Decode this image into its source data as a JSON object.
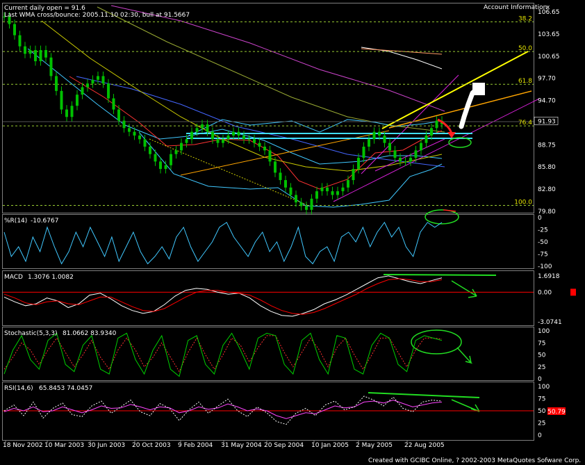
{
  "header": {
    "line1": "Current daily open = 91.6",
    "line2": "Last WMA cross/bounce: 2005.11.10 02:30, bull at 91.5667",
    "account_info": "Account Information",
    "close_glyph": "x"
  },
  "credit": "Created with GCIBC Online, ? 2002-2003 MetaQuotes Sofware Corp.",
  "chart_data": [
    {
      "type": "line",
      "name_label": "",
      "x_tick_labels": [
        "18 Nov 2002",
        "10 Mar 2003",
        "30 Jun 2003",
        "20 Oct 2003",
        "9 Feb 2004",
        "31 May 2004",
        "20 Sep 2004",
        "10 Jan 2005",
        "2 May 2005",
        "22 Aug 2005"
      ],
      "y_tick_labels": [
        "106.65",
        "103.65",
        "100.65",
        "97.70",
        "94.70",
        "91.93",
        "88.75",
        "85.80",
        "82.80",
        "79.80"
      ],
      "ylim": [
        79.8,
        106.65
      ],
      "current_price": "91.93",
      "fib_levels": [
        {
          "label": "38.2",
          "value": 105.3
        },
        {
          "label": "50.0",
          "value": 101.3
        },
        {
          "label": "61.8",
          "value": 96.9
        },
        {
          "label": "76.4",
          "value": 91.3
        },
        {
          "label": "100.0",
          "value": 80.6
        }
      ],
      "close": [
        106.0,
        105.0,
        103.5,
        102.0,
        101.0,
        101.5,
        100.0,
        101.5,
        100.5,
        98.0,
        96.0,
        93.5,
        92.5,
        94.0,
        95.5,
        96.5,
        97.0,
        97.5,
        98.0,
        97.0,
        95.0,
        93.5,
        92.0,
        91.0,
        90.5,
        90.0,
        89.5,
        88.5,
        87.5,
        86.5,
        85.5,
        86.0,
        87.5,
        88.0,
        89.0,
        89.5,
        90.5,
        91.0,
        91.5,
        90.5,
        89.5,
        89.0,
        89.5,
        90.0,
        90.5,
        90.0,
        89.5,
        89.5,
        89.0,
        88.5,
        88.0,
        86.5,
        85.0,
        84.0,
        83.0,
        82.0,
        81.0,
        80.5,
        80.0,
        81.5,
        82.5,
        83.0,
        82.5,
        82.0,
        82.5,
        83.0,
        84.0,
        85.5,
        87.0,
        88.5,
        89.5,
        90.5,
        90.0,
        89.0,
        88.0,
        87.0,
        86.5,
        86.5,
        87.0,
        88.0,
        89.0,
        90.0,
        91.0,
        92.0,
        91.5
      ]
    },
    {
      "type": "line",
      "name_label": "%R(14)",
      "values_label": "-10.6767",
      "y_tick_labels": [
        "0",
        "-25",
        "-50",
        "-75",
        "-100"
      ],
      "ylim": [
        -100,
        0
      ],
      "values": [
        -30,
        -80,
        -60,
        -90,
        -40,
        -70,
        -20,
        -60,
        -95,
        -70,
        -30,
        -60,
        -20,
        -50,
        -80,
        -40,
        -90,
        -60,
        -30,
        -70,
        -95,
        -80,
        -60,
        -85,
        -40,
        -20,
        -60,
        -90,
        -70,
        -50,
        -20,
        -10,
        -40,
        -60,
        -80,
        -50,
        -30,
        -70,
        -50,
        -90,
        -60,
        -20,
        -80,
        -95,
        -70,
        -60,
        -90,
        -40,
        -30,
        -50,
        -20,
        -60,
        -30,
        -10,
        -40,
        -20,
        -60,
        -80,
        -30,
        -10,
        -20,
        -10
      ]
    },
    {
      "type": "line",
      "name_label": "MACD",
      "values_label": "1.3076 1.0082",
      "y_tick_labels": [
        "1.6918",
        "0.00",
        "-3.0741"
      ],
      "ylim": [
        -3.0741,
        1.6918
      ],
      "series": [
        {
          "name": "main",
          "values": [
            -0.5,
            -1.0,
            -1.4,
            -1.2,
            -0.6,
            -0.9,
            -1.6,
            -1.2,
            -0.3,
            -0.1,
            -0.7,
            -1.4,
            -1.9,
            -2.2,
            -2.0,
            -1.3,
            -0.4,
            0.2,
            0.4,
            0.3,
            0.0,
            -0.2,
            -0.1,
            -0.6,
            -1.4,
            -2.0,
            -2.4,
            -2.5,
            -2.2,
            -1.8,
            -1.2,
            -0.8,
            -0.3,
            0.3,
            0.9,
            1.5,
            1.7,
            1.4,
            1.1,
            0.9,
            1.2,
            1.5
          ]
        },
        {
          "name": "signal",
          "values": [
            -0.2,
            -0.6,
            -1.1,
            -1.3,
            -1.0,
            -0.9,
            -1.2,
            -1.3,
            -0.9,
            -0.5,
            -0.5,
            -1.0,
            -1.5,
            -1.9,
            -2.0,
            -1.7,
            -1.1,
            -0.5,
            0.0,
            0.2,
            0.2,
            0.0,
            -0.1,
            -0.3,
            -0.8,
            -1.4,
            -1.9,
            -2.2,
            -2.3,
            -2.1,
            -1.7,
            -1.2,
            -0.7,
            -0.2,
            0.4,
            0.9,
            1.3,
            1.4,
            1.3,
            1.1,
            1.1,
            1.3
          ]
        }
      ]
    },
    {
      "type": "line",
      "name_label": "Stochastic(5,3,3)",
      "values_label": "81.0662 83.9340",
      "y_tick_labels": [
        "100",
        "75",
        "50",
        "25",
        "0"
      ],
      "ylim": [
        0,
        100
      ],
      "series": [
        {
          "name": "main",
          "values": [
            10,
            60,
            90,
            40,
            20,
            80,
            95,
            30,
            15,
            70,
            90,
            20,
            10,
            85,
            95,
            40,
            10,
            60,
            90,
            20,
            5,
            80,
            90,
            30,
            10,
            70,
            95,
            60,
            20,
            85,
            95,
            90,
            30,
            10,
            80,
            95,
            40,
            10,
            90,
            85,
            20,
            10,
            70,
            95,
            85,
            30,
            15,
            80,
            90,
            85,
            80
          ]
        },
        {
          "name": "signal",
          "values": [
            20,
            45,
            75,
            60,
            30,
            60,
            85,
            55,
            25,
            50,
            80,
            45,
            20,
            60,
            85,
            60,
            25,
            45,
            75,
            45,
            15,
            55,
            85,
            50,
            20,
            50,
            85,
            70,
            35,
            65,
            90,
            90,
            55,
            25,
            55,
            85,
            60,
            25,
            65,
            85,
            50,
            20,
            50,
            85,
            85,
            55,
            25,
            60,
            85,
            85,
            83
          ]
        }
      ]
    },
    {
      "type": "line",
      "name_label": "RSI(14,6)",
      "values_label": "65.8453 74.0457",
      "y_tick_labels": [
        "100",
        "75",
        "50",
        "25",
        "0"
      ],
      "ylim": [
        0,
        100
      ],
      "current_value": "50.79",
      "series": [
        {
          "name": "rsi",
          "values": [
            50,
            62,
            40,
            68,
            35,
            55,
            66,
            42,
            38,
            60,
            70,
            45,
            58,
            72,
            48,
            40,
            65,
            55,
            30,
            52,
            68,
            45,
            60,
            74,
            50,
            38,
            58,
            46,
            28,
            22,
            45,
            55,
            40,
            62,
            70,
            52,
            58,
            80,
            72,
            60,
            78,
            55,
            48,
            68,
            72,
            70
          ]
        },
        {
          "name": "ma",
          "values": [
            48,
            55,
            50,
            58,
            48,
            50,
            58,
            52,
            46,
            52,
            60,
            55,
            56,
            63,
            58,
            52,
            58,
            56,
            46,
            50,
            58,
            53,
            56,
            64,
            58,
            50,
            54,
            50,
            40,
            34,
            40,
            46,
            44,
            52,
            60,
            56,
            58,
            68,
            70,
            66,
            72,
            65,
            58,
            62,
            66,
            68
          ]
        }
      ]
    }
  ],
  "colors": {
    "background": "#000000",
    "price_bars": "#00c000",
    "fib_line": "#9acd32",
    "cyan_level": "#40e0ff",
    "ma_yellow": "#ffff00",
    "ma_orange": "#ffa500",
    "magenta": "#ff00ff",
    "percentR": "#40c8ff",
    "macd_main": "#ffffff",
    "macd_signal": "#ff0000",
    "stoch_main": "#00d000",
    "stoch_signal": "#ff3030",
    "rsi_main": "#ff44ff",
    "rsi_ma": "#ffffff",
    "annotation_green": "#22dd22",
    "annotation_red": "#ff2020",
    "zero_line": "#ff0000"
  },
  "icons": [
    "close-icon",
    "arrow-down-icon"
  ]
}
